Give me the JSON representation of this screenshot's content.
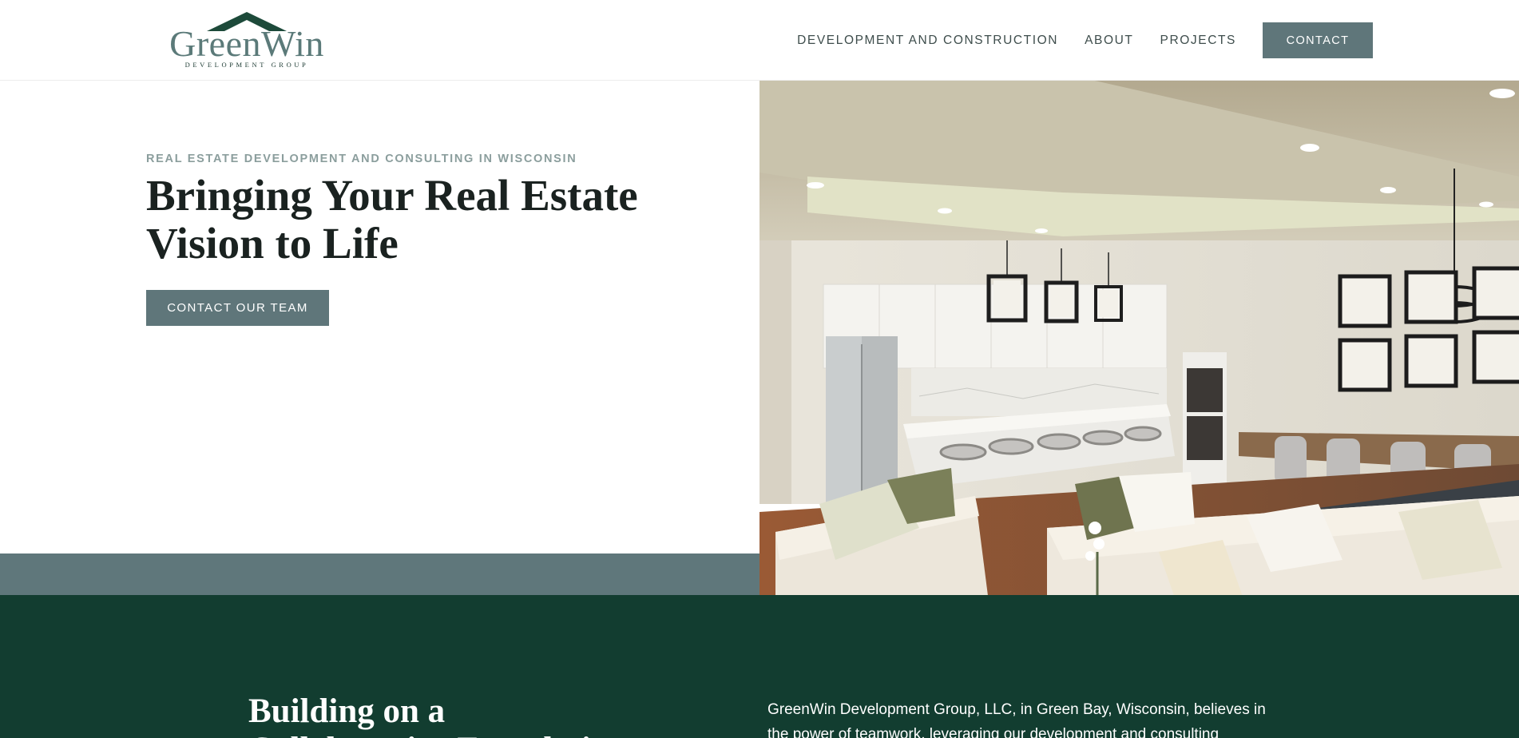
{
  "brand": {
    "name": "GreenWin",
    "tagline": "DEVELOPMENT GROUP",
    "colors": {
      "slate": "#5f767a",
      "forest": "#123d30",
      "roof": "#1d4a3a"
    }
  },
  "nav": {
    "links": [
      "DEVELOPMENT AND CONSTRUCTION",
      "ABOUT",
      "PROJECTS"
    ],
    "cta": "CONTACT"
  },
  "hero": {
    "eyebrow": "REAL ESTATE DEVELOPMENT AND CONSULTING IN WISCONSIN",
    "title": "Bringing Your Real Estate Vision to Life",
    "button": "CONTACT OUR TEAM",
    "image": "kitchen-dining-living-interior"
  },
  "about": {
    "title": "Building on a Collaborative Foundation",
    "text": "GreenWin Development Group, LLC, in Green Bay, Wisconsin, believes in the power of teamwork, leveraging our development and consulting"
  }
}
